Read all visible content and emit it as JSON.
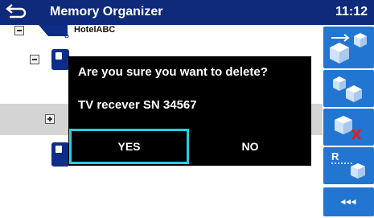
{
  "header": {
    "title": "Memory Organizer",
    "time": "11:12"
  },
  "tree": {
    "partial_label": "HotelABC"
  },
  "dialog": {
    "question": "Are you sure you want to delete?",
    "item": "TV recever SN 34567",
    "yes_label": "YES",
    "no_label": "NO"
  },
  "sidebar": {
    "buttons": [
      {
        "icon": "add-structure-icon"
      },
      {
        "icon": "copy-structure-icon"
      },
      {
        "icon": "delete-structure-icon"
      },
      {
        "icon": "rename-structure-icon",
        "text": "R"
      }
    ],
    "more_label": "◂◂◂"
  },
  "colors": {
    "header": "#0f2a7a",
    "accent": "#2276d2",
    "highlight": "#22d0e8",
    "delete": "#e0201a"
  }
}
